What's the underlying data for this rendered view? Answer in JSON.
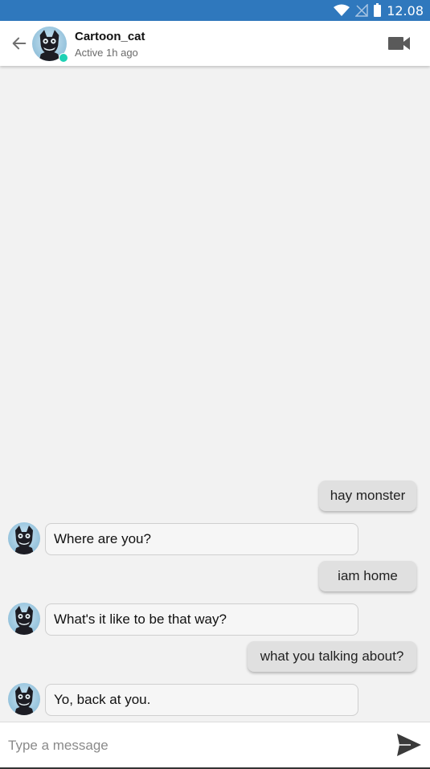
{
  "status_bar": {
    "time": "12.08",
    "icons": [
      "wifi-icon",
      "no-signal-icon",
      "battery-icon"
    ],
    "color": "#2f78bd"
  },
  "header": {
    "contact_name": "Cartoon_cat",
    "contact_status": "Active 1h ago",
    "back_icon": "arrow-left-icon",
    "video_icon": "video-camera-icon",
    "online_color": "#1fd1b4"
  },
  "messages": [
    {
      "direction": "out",
      "text": "hay monster"
    },
    {
      "direction": "in",
      "text": "Where are you?"
    },
    {
      "direction": "out",
      "text": "iam home"
    },
    {
      "direction": "in",
      "text": "What's it like to be that way?"
    },
    {
      "direction": "out",
      "text": "what you talking about?"
    },
    {
      "direction": "in",
      "text": "Yo, back at you."
    }
  ],
  "composer": {
    "placeholder": "Type a message",
    "value": "",
    "send_icon": "send-icon"
  }
}
